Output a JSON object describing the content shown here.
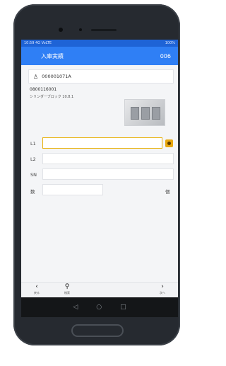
{
  "status": {
    "left": "10:59 4G VoLTE",
    "right": "100%"
  },
  "appbar": {
    "title": "入庫実績",
    "count": "006"
  },
  "order": {
    "number": "000001071A"
  },
  "product": {
    "code": "0800116001",
    "name": "シリンダーブロック 10.8.1"
  },
  "fields": {
    "l1_label": "L1",
    "l2_label": "L2",
    "sn_label": "SN",
    "qty_label": "数",
    "unit": "個"
  },
  "toolbar": {
    "back_label": "戻る",
    "search_label": "検索",
    "next_label": "次へ"
  },
  "icons": [
    "order-icon",
    "camera-icon",
    "chevron-left-icon",
    "search-icon",
    "chevron-right-icon",
    "nav-back-icon",
    "nav-home-icon",
    "nav-recent-icon"
  ]
}
